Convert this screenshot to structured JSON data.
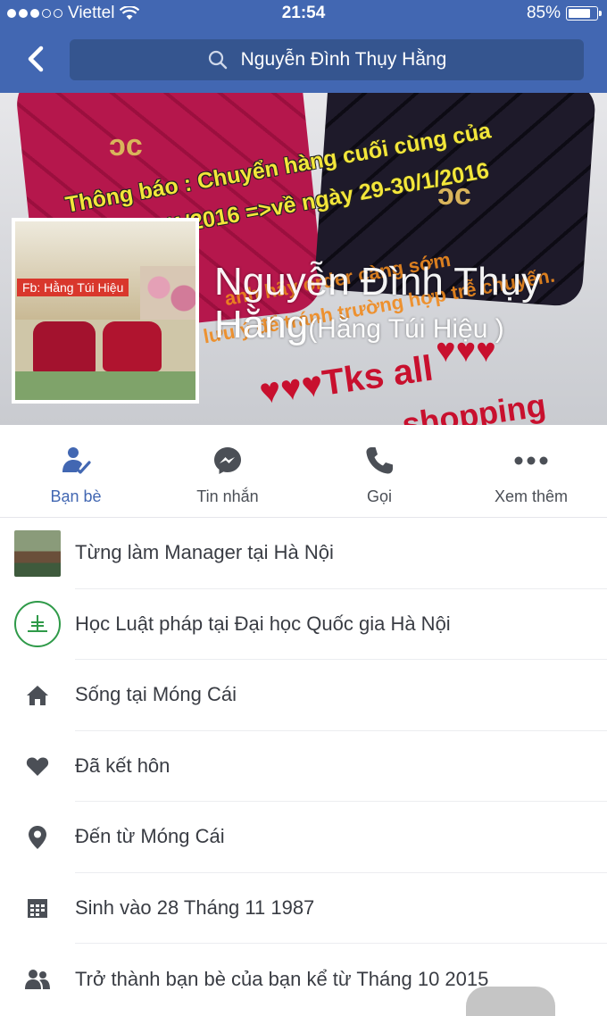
{
  "status_bar": {
    "carrier": "Viettel",
    "time": "21:54",
    "battery": "85%",
    "battery_level": 0.85
  },
  "nav": {
    "search_text": "Nguyễn Đình Thụy Hằng"
  },
  "cover": {
    "notice_line1": "Thông báo : Chuyển hàng cuối cùng của",
    "notice_line2": "ngày25/1/2016 =>về ngày 29-30/1/2016",
    "orange_line1": "anh hãy order càng sớm",
    "orange_line2": "lưu ý để tránh trường hợp trễ chuyến.",
    "tks": "Tks all",
    "shopping": "shopping",
    "profile_pic_label": "Fb: Hằng Túi Hiệu"
  },
  "profile": {
    "name_line1": "Nguyễn Đình Thụy",
    "name_line2": "Hằng",
    "alternate_name": "(Hằng Túi Hiệu )"
  },
  "actions": [
    {
      "label": "Bạn bè",
      "icon": "friends-icon",
      "active": true
    },
    {
      "label": "Tin nhắn",
      "icon": "messenger-icon"
    },
    {
      "label": "Gọi",
      "icon": "phone-icon"
    },
    {
      "label": "Xem thêm",
      "icon": "more-icon"
    }
  ],
  "info": [
    {
      "text": "Từng làm Manager tại Hà Nội",
      "icon": "work-thumbnail"
    },
    {
      "text": "Học Luật pháp tại Đại học Quốc gia Hà Nội",
      "icon": "school-logo"
    },
    {
      "text": "Sống tại Móng Cái",
      "icon": "home-icon"
    },
    {
      "text": "Đã kết hôn",
      "icon": "heart-icon"
    },
    {
      "text": "Đến từ Móng Cái",
      "icon": "location-pin-icon"
    },
    {
      "text": "Sinh vào 28 Tháng 11 1987",
      "icon": "calendar-icon"
    },
    {
      "text": "Trở thành bạn bè của bạn kể từ Tháng 10 2015",
      "icon": "friends-since-icon"
    }
  ],
  "colors": {
    "brand": "#4267b2",
    "brand_dark": "#35558f",
    "icon_gray": "#4b4f56"
  }
}
